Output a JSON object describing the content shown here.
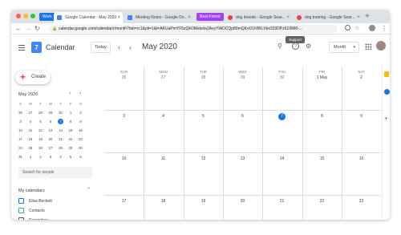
{
  "browser": {
    "tabs": [
      {
        "label": "Work",
        "type": "chip",
        "color": "#1a73e8"
      },
      {
        "label": "Google Calendar - May 2020",
        "type": "tab",
        "active": true,
        "favicon": "calendar-favicon"
      },
      {
        "label": "Meeting Notes - Google Do...",
        "type": "tab",
        "active": false,
        "favicon": "docs-favicon"
      },
      {
        "label": "Best Friend",
        "type": "chip",
        "color": "#a142f4"
      },
      {
        "label": "dog breeds - Google Sear...",
        "type": "tab",
        "active": false,
        "favicon": "google-favicon"
      },
      {
        "label": "dog training - Google Sear...",
        "type": "tab",
        "active": false,
        "favicon": "google-favicon"
      }
    ],
    "new_tab": "+",
    "url": "calendar.google.com/calendar/r/month?tab=rc1&pli=1&t=AKUaPmYF5zQkOMsbela2AxyYtADCQp80mQKvO1NWLXbx329DPz61I9M0-..."
  },
  "header": {
    "app_name": "Calendar",
    "logo_day": "7",
    "today_label": "Today",
    "prev": "‹",
    "next": "›",
    "month_title": "May 2020",
    "view_label": "Month",
    "tooltip": "Support"
  },
  "sidebar": {
    "create_label": "Create",
    "mini_month": "May 2020",
    "mini_dow": [
      "S",
      "M",
      "T",
      "W",
      "T",
      "F",
      "S"
    ],
    "mini_weeks": [
      [
        "26",
        "27",
        "28",
        "29",
        "30",
        "1",
        "2"
      ],
      [
        "3",
        "4",
        "5",
        "6",
        "7",
        "8",
        "9"
      ],
      [
        "10",
        "11",
        "12",
        "13",
        "14",
        "15",
        "16"
      ],
      [
        "17",
        "18",
        "19",
        "20",
        "21",
        "22",
        "23"
      ],
      [
        "24",
        "25",
        "26",
        "27",
        "28",
        "29",
        "30"
      ],
      [
        "31",
        "1",
        "2",
        "3",
        "4",
        "5",
        "6"
      ]
    ],
    "search_placeholder": "Search for people",
    "my_calendars": "My calendars",
    "calendars": [
      {
        "label": "Elisa Beckett",
        "color": "#1a73e8"
      },
      {
        "label": "Contacts",
        "color": "#33b679"
      },
      {
        "label": "Reminders",
        "color": "#3f51b5"
      }
    ]
  },
  "month_grid": {
    "dow": [
      "SUN",
      "MON",
      "TUE",
      "WED",
      "THU",
      "FRI",
      "SAT"
    ],
    "weeks": [
      [
        "26",
        "27",
        "28",
        "29",
        "30",
        "1 May",
        "2"
      ],
      [
        "3",
        "4",
        "5",
        "6",
        "7",
        "8",
        "9"
      ],
      [
        "10",
        "11",
        "12",
        "13",
        "14",
        "15",
        "16"
      ],
      [
        "17",
        "18",
        "19",
        "20",
        "21",
        "22",
        "23"
      ]
    ]
  }
}
